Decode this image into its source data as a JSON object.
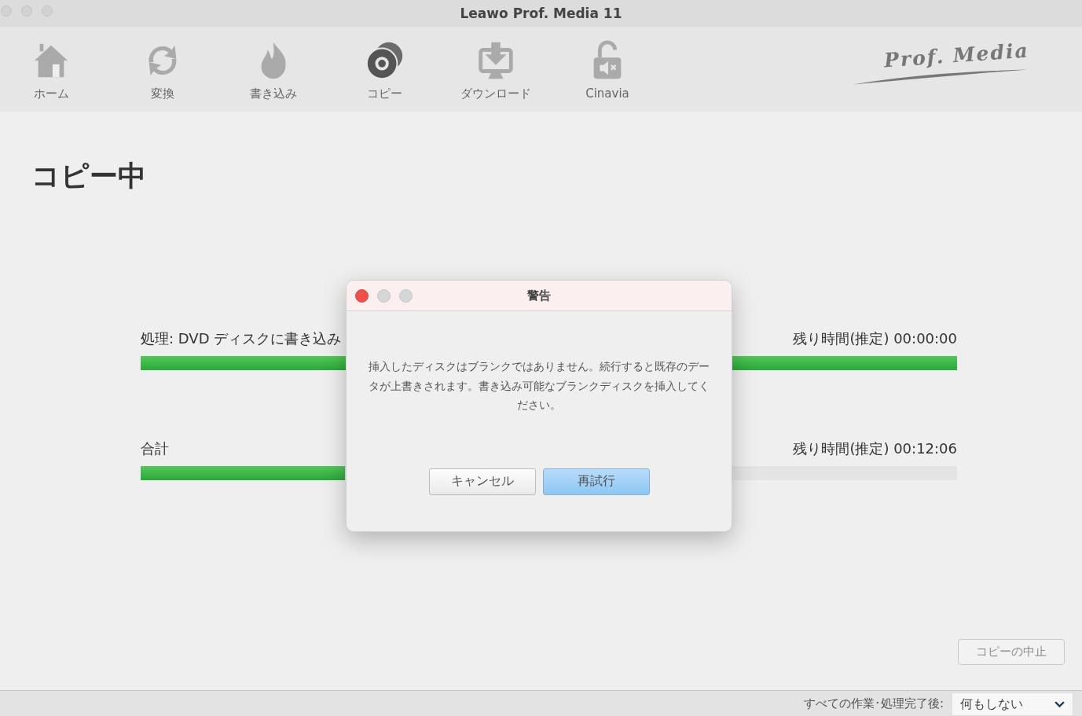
{
  "window": {
    "title": "Leawo Prof. Media 11"
  },
  "toolbar": [
    {
      "kind": "home",
      "label": "ホーム",
      "selected": false
    },
    {
      "kind": "convert",
      "label": "変換",
      "selected": false
    },
    {
      "kind": "burn",
      "label": "書き込み",
      "selected": false
    },
    {
      "kind": "copy",
      "label": "コピー",
      "selected": true
    },
    {
      "kind": "download",
      "label": "ダウンロード",
      "selected": false
    },
    {
      "kind": "cinavia",
      "label": "Cinavia",
      "selected": false
    }
  ],
  "logo": "Prof. Media",
  "heading": "コピー中",
  "progress": [
    {
      "label": "処理: DVD ディスクに書き込み",
      "remaining": "残り時間(推定) 00:00:00",
      "level": 1.0
    },
    {
      "label": "合計",
      "remaining": "残り時間(推定) 00:12:06",
      "level": 0.25
    }
  ],
  "stop_button": {
    "label": "コピーの中止",
    "disabled": true
  },
  "footer": {
    "label": "すべての作業･処理完了後:",
    "dropdown": "何もしない"
  },
  "dialog": {
    "title": "警告",
    "message": "挿入したディスクはブランクではありません。続行すると既存のデータが上書きされます。書き込み可能なブランクディスクを挿入してください。",
    "buttons": [
      {
        "label": "キャンセル",
        "primary": false
      },
      {
        "label": "再試行",
        "primary": true
      }
    ]
  }
}
